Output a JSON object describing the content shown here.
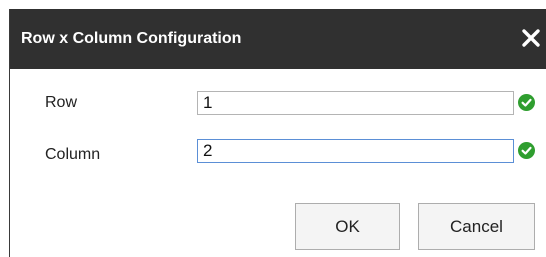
{
  "dialog": {
    "title": "Row x Column Configuration",
    "close_icon": "close-icon"
  },
  "fields": [
    {
      "label": "Row",
      "value": "1",
      "valid": true,
      "status_icon": "check-circle-icon"
    },
    {
      "label": "Column",
      "value": "2",
      "valid": true,
      "status_icon": "check-circle-icon"
    }
  ],
  "buttons": {
    "ok_label": "OK",
    "cancel_label": "Cancel"
  },
  "colors": {
    "titlebar": "#303030",
    "valid": "#2f9e2f",
    "focus_border": "#5b8fd6"
  }
}
